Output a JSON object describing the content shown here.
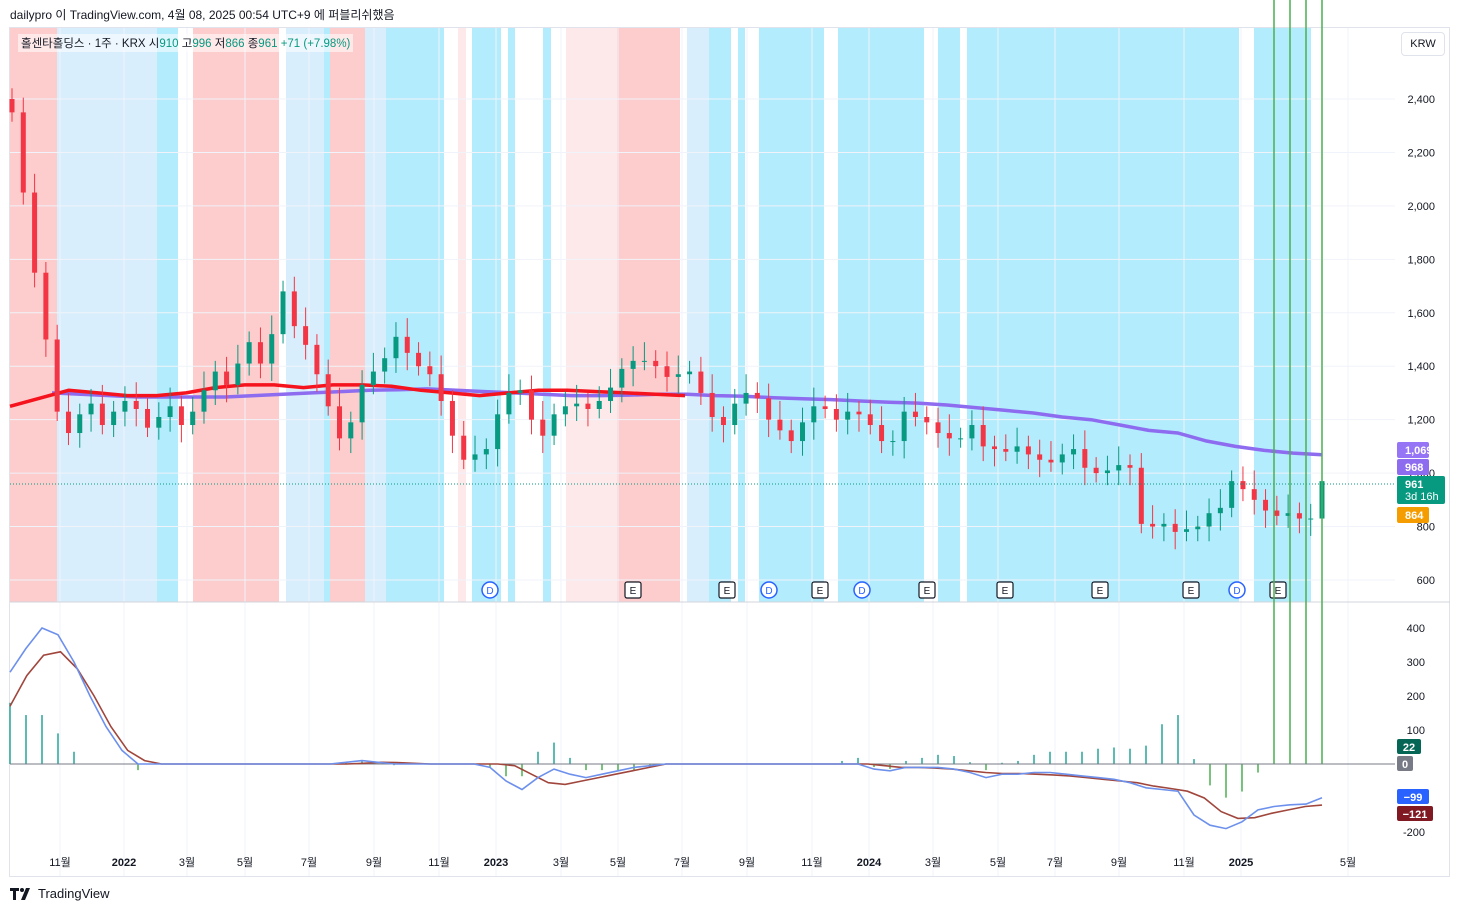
{
  "caption": "dailypro 이 TradingView.com, 4월 08, 2025 00:54 UTC+9 에 퍼블리쉬했음",
  "symbol": {
    "name": "홀센타홀딩스 · 1주 · KRX",
    "open_label": "시",
    "open": "910",
    "high_label": "고",
    "high": "996",
    "low_label": "저",
    "low": "866",
    "close_label": "종",
    "close": "961",
    "change": "+71 (+7.98%)"
  },
  "currency": "KRW",
  "footer": {
    "brand": "TradingView",
    "logo_icon": "tradingview-logo-icon"
  },
  "colors": {
    "up": "#089981",
    "down": "#f23645",
    "ema_long": "#8d6cf0",
    "ema_red": "#f5131d",
    "macd": "#6d90ec",
    "signal": "#a0463c",
    "band_blue": "#b3ecfd",
    "band_lightblue": "#d9eefc",
    "band_red": "#fdcccc",
    "band_pink": "#fde8ea"
  },
  "chart_data": [
    {
      "type": "candlestick",
      "ylim": [
        530,
        2480
      ],
      "yticks": [
        "600",
        "800",
        "1,000",
        "1,200",
        "1,400",
        "1,600",
        "1,800",
        "2,000",
        "2,200",
        "2,400"
      ],
      "xticks": [
        "11월",
        "2022",
        "3월",
        "5월",
        "7월",
        "9월",
        "11월",
        "2023",
        "3월",
        "5월",
        "7월",
        "9월",
        "11월",
        "2024",
        "3월",
        "5월",
        "7월",
        "9월",
        "11월",
        "2025",
        "5월"
      ],
      "price_labels": [
        {
          "value": "1,069",
          "color": "#9575f5"
        },
        {
          "value": "968",
          "color": "#8d6cf0"
        },
        {
          "value": "961",
          "sub": "3d 16h",
          "color": "#089981"
        },
        {
          "value": "864",
          "color": "#f59d00"
        }
      ],
      "event_markers": [
        "D",
        "E",
        "E",
        "D",
        "E",
        "D",
        "E",
        "E",
        "E",
        "E",
        "D",
        "E"
      ],
      "close_series": [
        2350,
        2050,
        1750,
        1500,
        1230,
        1150,
        1220,
        1260,
        1180,
        1230,
        1270,
        1240,
        1170,
        1210,
        1250,
        1180,
        1230,
        1310,
        1380,
        1330,
        1410,
        1490,
        1410,
        1520,
        1680,
        1550,
        1480,
        1370,
        1250,
        1130,
        1190,
        1330,
        1380,
        1430,
        1510,
        1450,
        1400,
        1370,
        1270,
        1140,
        1050,
        1070,
        1090,
        1220,
        1300,
        1310,
        1200,
        1140,
        1220,
        1250,
        1260,
        1240,
        1270,
        1320,
        1390,
        1420,
        1420,
        1400,
        1360,
        1370,
        1380,
        1300,
        1210,
        1180,
        1260,
        1300,
        1280,
        1200,
        1160,
        1120,
        1190,
        1250,
        1240,
        1200,
        1230,
        1220,
        1180,
        1120,
        1120,
        1230,
        1210,
        1190,
        1150,
        1130,
        1130,
        1180,
        1100,
        1090,
        1080,
        1100,
        1070,
        1050,
        1040,
        1070,
        1090,
        1020,
        1000,
        1010,
        1030,
        1020,
        810,
        800,
        810,
        780,
        790,
        800,
        850,
        870,
        970,
        940,
        900,
        860,
        840,
        850,
        830,
        830,
        970
      ],
      "ema_long_series": [
        1300,
        1295,
        1290,
        1285,
        1285,
        1285,
        1285,
        1290,
        1295,
        1300,
        1305,
        1310,
        1312,
        1315,
        1310,
        1305,
        1300,
        1295,
        1290,
        1290,
        1292,
        1295,
        1295,
        1290,
        1288,
        1282,
        1278,
        1275,
        1270,
        1265,
        1262,
        1255,
        1245,
        1235,
        1225,
        1210,
        1200,
        1180,
        1160,
        1150,
        1120,
        1100,
        1085,
        1075,
        1069
      ],
      "ema_red_series": [
        1250,
        1280,
        1310,
        1300,
        1290,
        1290,
        1300,
        1320,
        1330,
        1330,
        1320,
        1330,
        1330,
        1325,
        1310,
        1300,
        1290,
        1300,
        1310,
        1310,
        1305,
        1300,
        1295,
        1290
      ],
      "macd": {
        "ylim": [
          -265,
          435
        ],
        "yticks": [
          "400",
          "300",
          "200",
          "100",
          "0",
          "-200"
        ],
        "labels": [
          {
            "value": "22",
            "color": "#056656"
          },
          {
            "value": "0",
            "color": "#787b86"
          },
          {
            "value": "−99",
            "color": "#2962ff"
          },
          {
            "value": "−121",
            "color": "#801922"
          }
        ],
        "macd_series": [
          270,
          340,
          400,
          380,
          300,
          200,
          110,
          40,
          0,
          0,
          0,
          0,
          0,
          0,
          0,
          0,
          0,
          0,
          0,
          0,
          0,
          5,
          10,
          5,
          0,
          0,
          0,
          0,
          0,
          0,
          -10,
          -50,
          -75,
          -40,
          -15,
          -30,
          -40,
          -30,
          -20,
          -10,
          -5,
          0,
          0,
          0,
          0,
          0,
          0,
          0,
          0,
          0,
          0,
          0,
          0,
          0,
          -15,
          -20,
          -10,
          -10,
          -10,
          -15,
          -25,
          -40,
          -30,
          -30,
          -25,
          -25,
          -30,
          -35,
          -40,
          -45,
          -55,
          -70,
          -75,
          -80,
          -150,
          -180,
          -190,
          -170,
          -135,
          -125,
          -120,
          -118,
          -99
        ],
        "signal_series": [
          170,
          260,
          320,
          330,
          280,
          200,
          110,
          40,
          10,
          0,
          0,
          0,
          0,
          0,
          0,
          0,
          0,
          0,
          0,
          0,
          0,
          2,
          5,
          4,
          2,
          0,
          0,
          0,
          0,
          0,
          -5,
          -30,
          -55,
          -60,
          -50,
          -40,
          -30,
          -20,
          -10,
          0,
          0,
          0,
          0,
          0,
          0,
          0,
          0,
          0,
          0,
          0,
          0,
          0,
          -5,
          -10,
          -10,
          -12,
          -15,
          -20,
          -25,
          -28,
          -28,
          -30,
          -32,
          -35,
          -40,
          -45,
          -50,
          -55,
          -65,
          -72,
          -80,
          -100,
          -140,
          -160,
          -158,
          -145,
          -135,
          -125,
          -121
        ]
      }
    }
  ]
}
